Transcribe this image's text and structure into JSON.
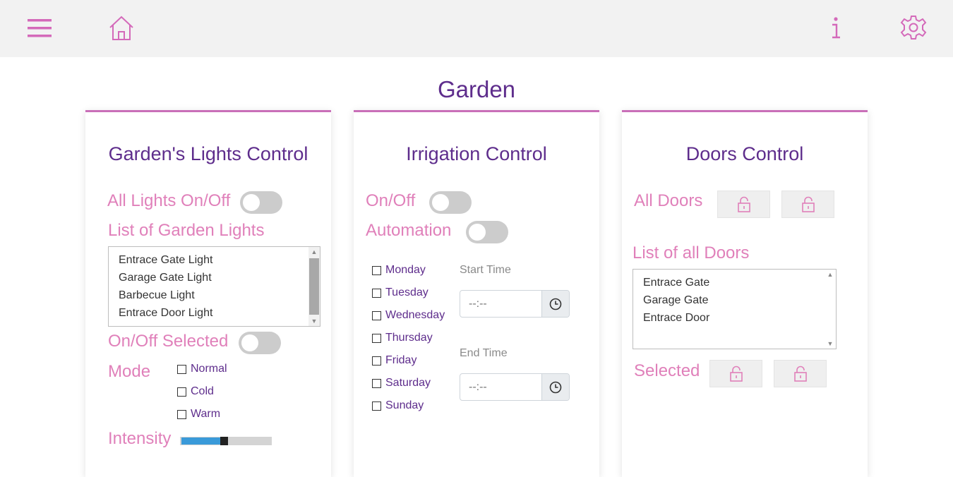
{
  "header": {
    "menu_icon": "hamburger-menu-icon",
    "home_icon": "home-icon",
    "info_icon": "info-icon",
    "settings_icon": "gear-icon"
  },
  "page": {
    "title": "Garden"
  },
  "lights": {
    "title": "Garden's Lights Control",
    "all_lights_label": "All Lights On/Off",
    "all_lights_on": false,
    "list_label": "List of Garden Lights",
    "items": [
      "Entrace Gate Light",
      "Garage Gate Light",
      "Barbecue Light",
      "Entrace Door Light"
    ],
    "selected_label": "On/Off Selected",
    "selected_on": false,
    "mode_label": "Mode",
    "modes": [
      "Normal",
      "Cold",
      "Warm"
    ],
    "intensity_label": "Intensity",
    "intensity_percent": 50
  },
  "irrigation": {
    "title": "Irrigation Control",
    "onoff_label": "On/Off",
    "onoff_on": false,
    "automation_label": "Automation",
    "automation_on": false,
    "days": [
      "Monday",
      "Tuesday",
      "Wednesday",
      "Thursday",
      "Friday",
      "Saturday",
      "Sunday"
    ],
    "start_label": "Start Time",
    "start_value": "--:--",
    "end_label": "End Time",
    "end_value": "--:--"
  },
  "doors": {
    "title": "Doors Control",
    "all_label": "All Doors",
    "list_label": "List of all Doors",
    "items": [
      "Entrace Gate",
      "Garage Gate",
      "Entrace Door"
    ],
    "selected_label": "Selected"
  },
  "colors": {
    "accent_pink": "#e080ba",
    "title_purple": "#5e2d8c",
    "icon_pink": "#d46aba",
    "slider_fill": "#3a9ad9"
  }
}
